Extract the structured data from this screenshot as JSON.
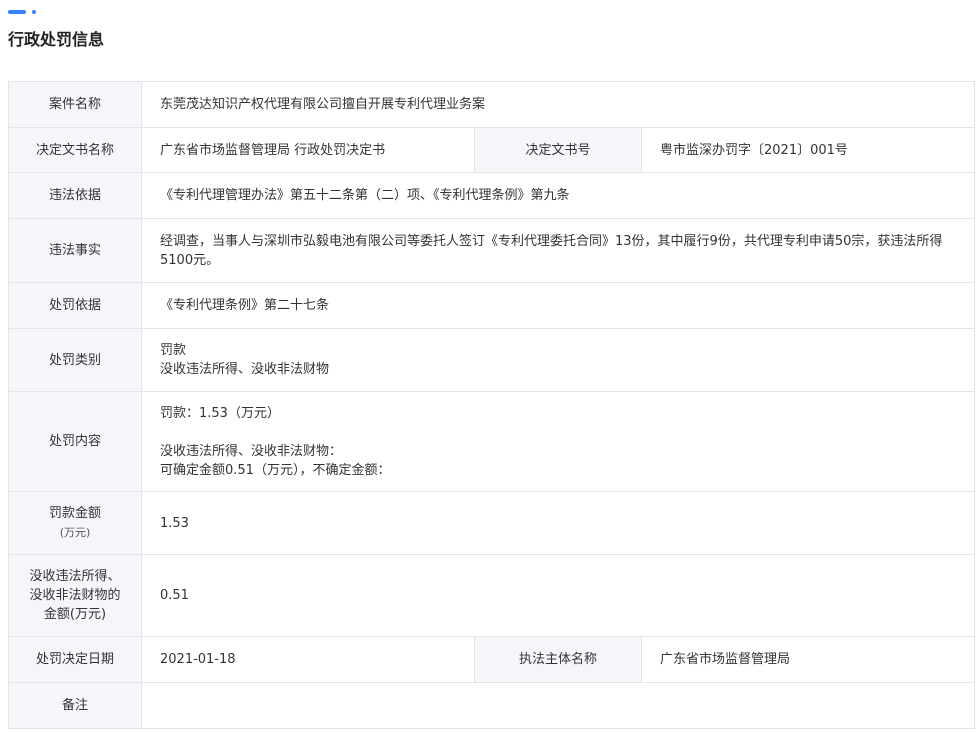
{
  "colors": {
    "accent": "#3b82f6",
    "label_bg": "#f5f6fa",
    "border": "#e4e4e4"
  },
  "section_title": "行政处罚信息",
  "case_name": {
    "label": "案件名称",
    "value": "东莞茂达知识产权代理有限公司擅自开展专利代理业务案"
  },
  "decision_doc": {
    "name_label": "决定文书名称",
    "name_value": "广东省市场监督管理局 行政处罚决定书",
    "number_label": "决定文书号",
    "number_value": "粤市监深办罚字〔2021〕001号"
  },
  "violation_basis": {
    "label": "违法依据",
    "value": "《专利代理管理办法》第五十二条第（二）项、《专利代理条例》第九条"
  },
  "violation_facts": {
    "label": "违法事实",
    "value": "经调查，当事人与深圳市弘毅电池有限公司等委托人签订《专利代理委托合同》13份，其中履行9份，共代理专利申请50宗，获违法所得5100元。"
  },
  "penalty_basis": {
    "label": "处罚依据",
    "value": "《专利代理条例》第二十七条"
  },
  "penalty_type": {
    "label": "处罚类别",
    "line1": "罚款",
    "line2": "没收违法所得、没收非法财物"
  },
  "penalty_content": {
    "label": "处罚内容",
    "line1": "罚款：1.53（万元）",
    "line2": "没收违法所得、没收非法财物：",
    "line3": "可确定金额0.51（万元），不确定金额："
  },
  "fine_amount": {
    "label": "罚款金额",
    "unit": "(万元)",
    "value": "1.53"
  },
  "confiscation_amount": {
    "label_line1": "没收违法所得、",
    "label_line2": "没收非法财物的",
    "label_line3": "金额(万元)",
    "value": "0.51"
  },
  "decision_date": {
    "label": "处罚决定日期",
    "value": "2021-01-18",
    "authority_label": "执法主体名称",
    "authority_value": "广东省市场监督管理局"
  },
  "remarks": {
    "label": "备注",
    "value": ""
  }
}
